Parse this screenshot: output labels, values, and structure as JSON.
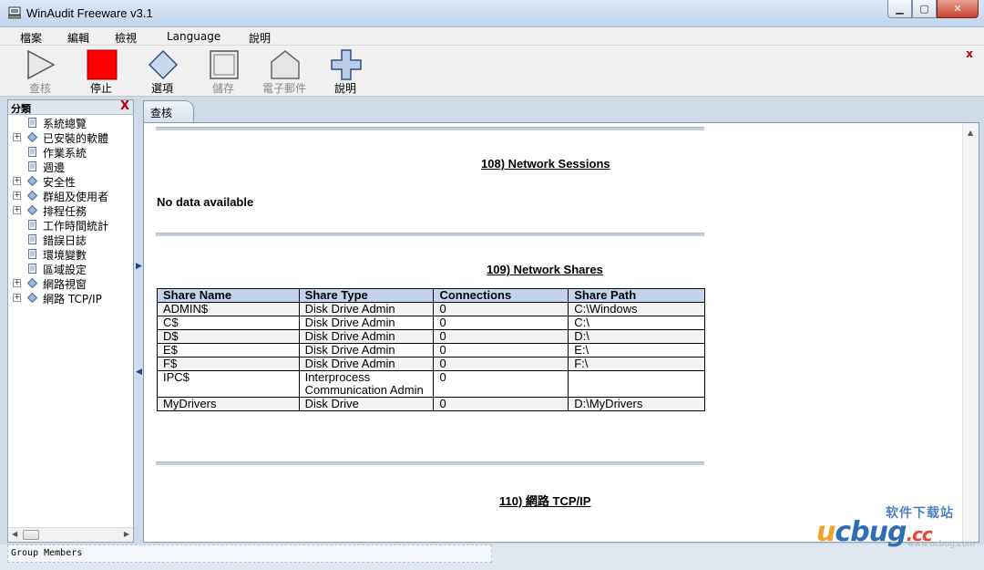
{
  "window": {
    "title": "WinAudit Freeware v3.1"
  },
  "menu": [
    "檔案",
    "編輯",
    "檢視",
    "Language",
    "說明"
  ],
  "toolbar": {
    "buttons": [
      {
        "label": "查核",
        "icon": "play-icon",
        "enabled": false
      },
      {
        "label": "停止",
        "icon": "stop-icon",
        "enabled": true
      },
      {
        "label": "選項",
        "icon": "options-diamond-icon",
        "enabled": true
      },
      {
        "label": "儲存",
        "icon": "save-icon",
        "enabled": false
      },
      {
        "label": "電子郵件",
        "icon": "email-icon",
        "enabled": false
      },
      {
        "label": "說明",
        "icon": "help-plus-icon",
        "enabled": true
      }
    ],
    "close_label": "x"
  },
  "sidebar": {
    "title": "分類",
    "close_label": "X",
    "items": [
      {
        "label": "系統總覽",
        "expandable": false,
        "icon": "page-icon"
      },
      {
        "label": "已安裝的軟體",
        "expandable": true,
        "icon": "diamond-icon"
      },
      {
        "label": "作業系統",
        "expandable": false,
        "icon": "page-icon"
      },
      {
        "label": "週邊",
        "expandable": false,
        "icon": "page-icon"
      },
      {
        "label": "安全性",
        "expandable": true,
        "icon": "diamond-icon"
      },
      {
        "label": "群組及使用者",
        "expandable": true,
        "icon": "diamond-icon"
      },
      {
        "label": "排程任務",
        "expandable": true,
        "icon": "diamond-icon"
      },
      {
        "label": "工作時間統計",
        "expandable": false,
        "icon": "page-icon"
      },
      {
        "label": "錯誤日誌",
        "expandable": false,
        "icon": "page-icon"
      },
      {
        "label": "環境變數",
        "expandable": false,
        "icon": "page-icon"
      },
      {
        "label": "區域設定",
        "expandable": false,
        "icon": "page-icon"
      },
      {
        "label": "網路視窗",
        "expandable": true,
        "icon": "diamond-icon"
      },
      {
        "label": "網路 TCP/IP",
        "expandable": true,
        "icon": "diamond-icon"
      }
    ]
  },
  "tabs": [
    {
      "label": "查核",
      "active": true
    }
  ],
  "report": {
    "section108": {
      "title": "108) Network Sessions",
      "message": "No data available"
    },
    "section109": {
      "title": "109) Network Shares",
      "columns": [
        "Share Name",
        "Share Type",
        "Connections",
        "Share Path"
      ],
      "rows": [
        [
          "ADMIN$",
          "Disk Drive Admin",
          "0",
          "C:\\Windows"
        ],
        [
          "C$",
          "Disk Drive Admin",
          "0",
          "C:\\"
        ],
        [
          "D$",
          "Disk Drive Admin",
          "0",
          "D:\\"
        ],
        [
          "E$",
          "Disk Drive Admin",
          "0",
          "E:\\"
        ],
        [
          "F$",
          "Disk Drive Admin",
          "0",
          "F:\\"
        ],
        [
          "IPC$",
          "Interprocess Communication Admin",
          "0",
          ""
        ],
        [
          "MyDrivers",
          "Disk Drive",
          "0",
          "D:\\MyDrivers"
        ]
      ]
    },
    "section110": {
      "title": "110) 網路 TCP/IP"
    }
  },
  "status": {
    "text": "Group Members"
  },
  "watermark": {
    "site_cn": "软件下载站",
    "brand_u": "u",
    "brand_bug": "cbug",
    "brand_cc": ".cc",
    "url": "www.ucbug.com"
  },
  "colors": {
    "accent": "#2f6db5",
    "header_row": "#c4d3ec",
    "stop": "#ff0000",
    "close": "#c00000"
  }
}
